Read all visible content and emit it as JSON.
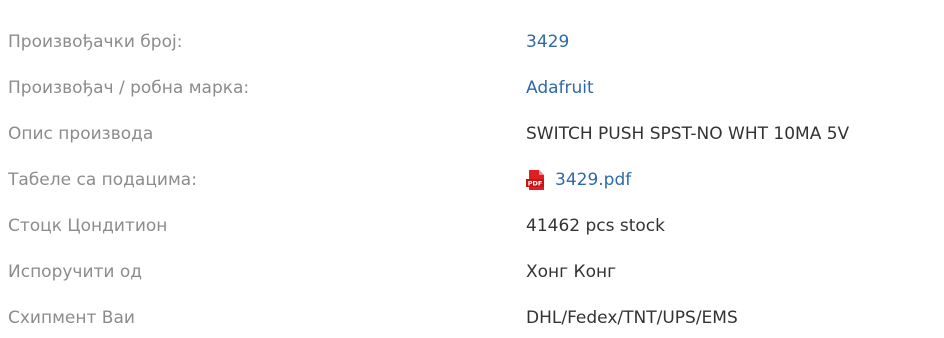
{
  "specs": [
    {
      "label": "Произвођачки број:",
      "value": "3429",
      "type": "link"
    },
    {
      "label": "Произвођач / робна марка:",
      "value": "Adafruit",
      "type": "link"
    },
    {
      "label": "Опис производа",
      "value": "SWITCH PUSH SPST-NO WHT 10MA 5V",
      "type": "text"
    },
    {
      "label": "Табеле са подацима:",
      "value": "3429.pdf",
      "type": "pdf",
      "icon": "pdf-icon",
      "icon_text": "PDF"
    },
    {
      "label": "Стоцк Цондитион",
      "value": "41462 pcs stock",
      "type": "text"
    },
    {
      "label": "Испоручити од",
      "value": "Хонг Конг",
      "type": "text"
    },
    {
      "label": "Схипмент Ваи",
      "value": "DHL/Fedex/TNT/UPS/EMS",
      "type": "text"
    }
  ],
  "colors": {
    "label": "#8c8c8c",
    "value": "#333333",
    "link": "#2f6aa8",
    "pdf_icon": "#e02020"
  }
}
